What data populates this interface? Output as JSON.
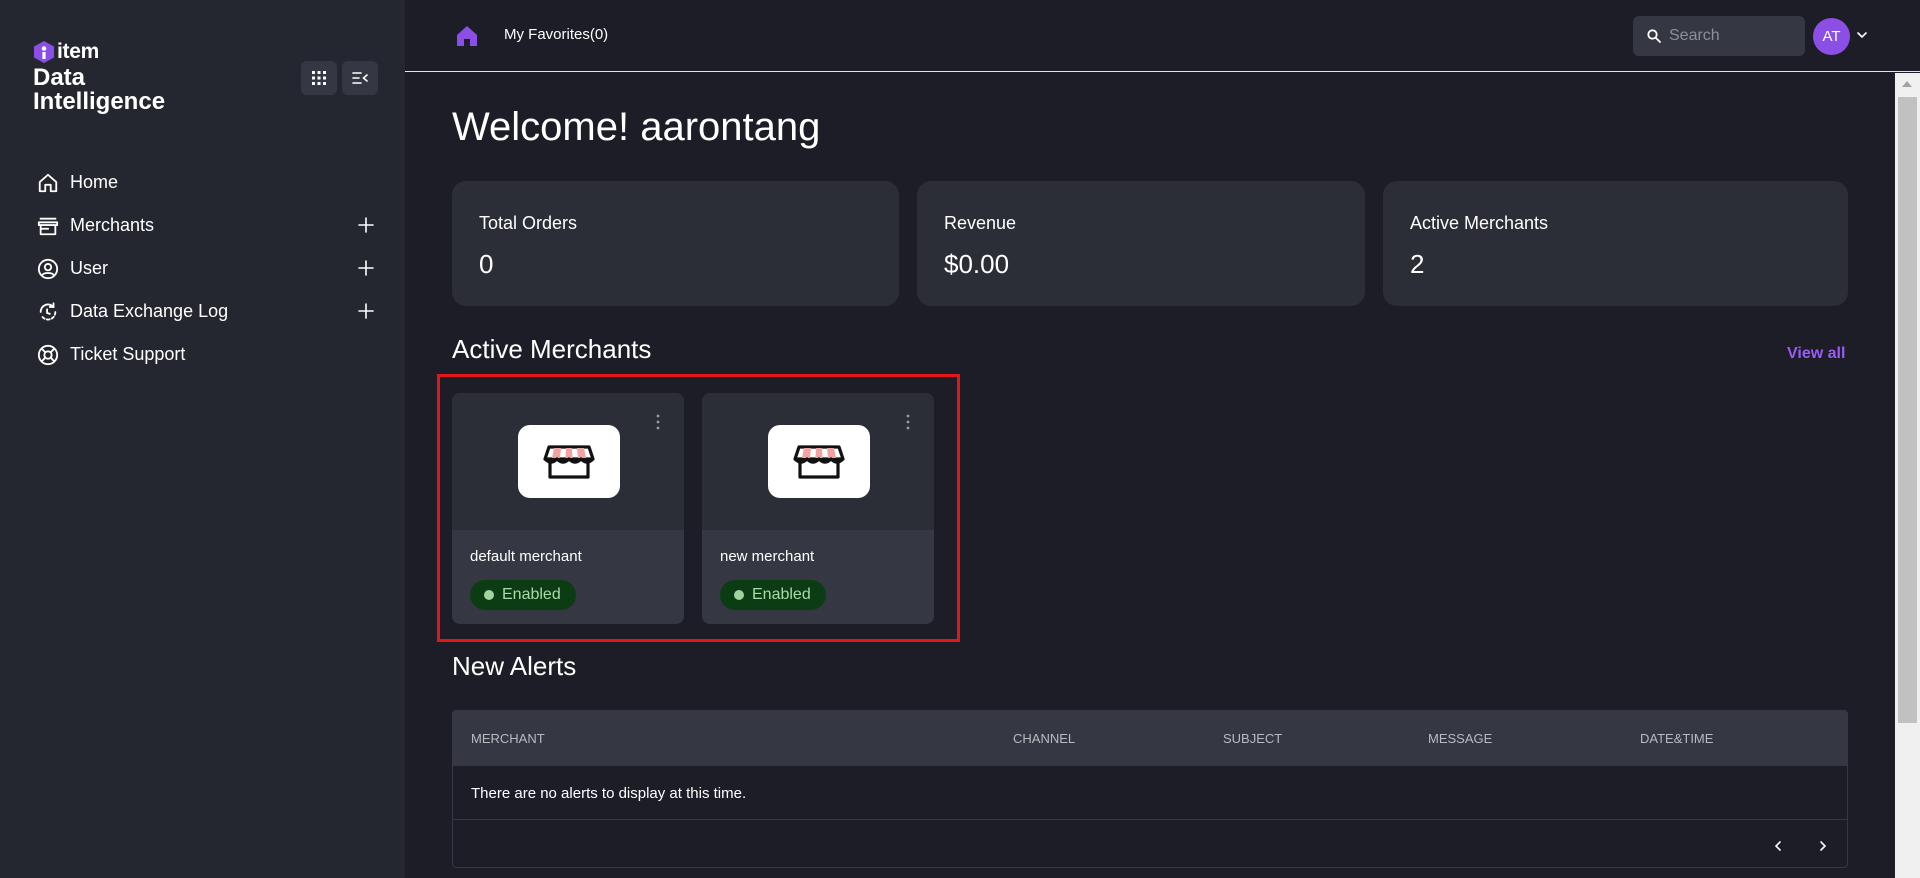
{
  "sidebar": {
    "logo_text": "item",
    "logo_subtitle": "Data Intelligence",
    "items": [
      {
        "label": "Home",
        "icon": "home-icon",
        "expandable": false
      },
      {
        "label": "Merchants",
        "icon": "store-icon",
        "expandable": true
      },
      {
        "label": "User",
        "icon": "user-icon",
        "expandable": true
      },
      {
        "label": "Data Exchange Log",
        "icon": "sync-icon",
        "expandable": true
      },
      {
        "label": "Ticket Support",
        "icon": "lifebuoy-icon",
        "expandable": false
      }
    ]
  },
  "header": {
    "favorites_label": "My Favorites(0)",
    "search_placeholder": "Search",
    "avatar_initials": "AT"
  },
  "main": {
    "welcome": "Welcome! aarontang",
    "stats": [
      {
        "label": "Total Orders",
        "value": "0"
      },
      {
        "label": "Revenue",
        "value": "$0.00"
      },
      {
        "label": "Active Merchants",
        "value": "2"
      }
    ],
    "active_merchants": {
      "title": "Active Merchants",
      "view_all": "View all",
      "merchants": [
        {
          "name": "default merchant",
          "status": "Enabled"
        },
        {
          "name": "new merchant",
          "status": "Enabled"
        }
      ]
    },
    "alerts": {
      "title": "New Alerts",
      "columns": [
        "MERCHANT",
        "CHANNEL",
        "SUBJECT",
        "MESSAGE",
        "DATE&TIME"
      ],
      "empty_message": "There are no alerts to display at this time."
    }
  },
  "colors": {
    "background": "#1c1d26",
    "sidebar": "#252730",
    "card": "#2b2d37",
    "accent": "#9b5cf6",
    "status_enabled_bg": "#0c3c14",
    "status_enabled_text": "#a7dca8",
    "highlight": "#e4141b"
  }
}
